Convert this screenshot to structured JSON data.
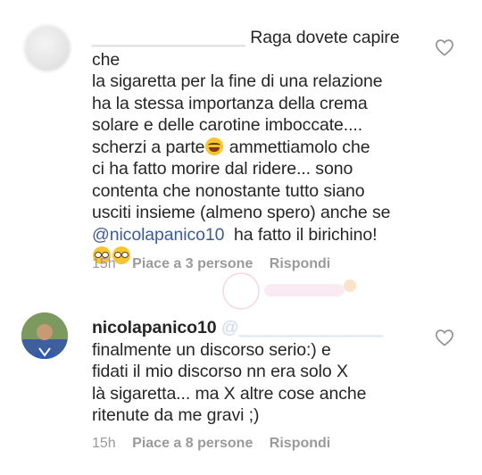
{
  "comments": [
    {
      "username": "________________",
      "text_lines": [
        "Raga dovete capire che",
        "la sigaretta per la fine di una relazione",
        "ha la stessa importanza della crema",
        "solare e delle carotine imboccate....",
        "scherzi a parte",
        "ammettiamolo che",
        "ci ha fatto morire dal ridere... sono",
        "contenta che nonostante tutto siano",
        "usciti insieme (almeno spero) anche se",
        "@nicolapanico10",
        "ha fatto il birichino!"
      ],
      "time": "15h",
      "likes": "Piace a 3 persone",
      "reply": "Rispondi",
      "emojis": [
        "laughing-emoji",
        "glasses-emoji",
        "glasses-emoji"
      ]
    },
    {
      "username": "nicolapanico10",
      "mention_redacted": "@_______________",
      "text_lines": [
        "finalmente un discorso serio:) e",
        "fidati il mio discorso nn era solo X",
        "là sigaretta... ma X altre cose anche",
        "ritenute da me gravi ;)"
      ],
      "time": "15h",
      "likes": "Piace a 8 persone",
      "reply": "Rispondi"
    }
  ],
  "colors": {
    "text": "#262626",
    "meta": "#9a9a9a",
    "mention": "#3b5b9a",
    "heart": "#8e8e8e"
  },
  "icons": [
    "heart-icon"
  ]
}
